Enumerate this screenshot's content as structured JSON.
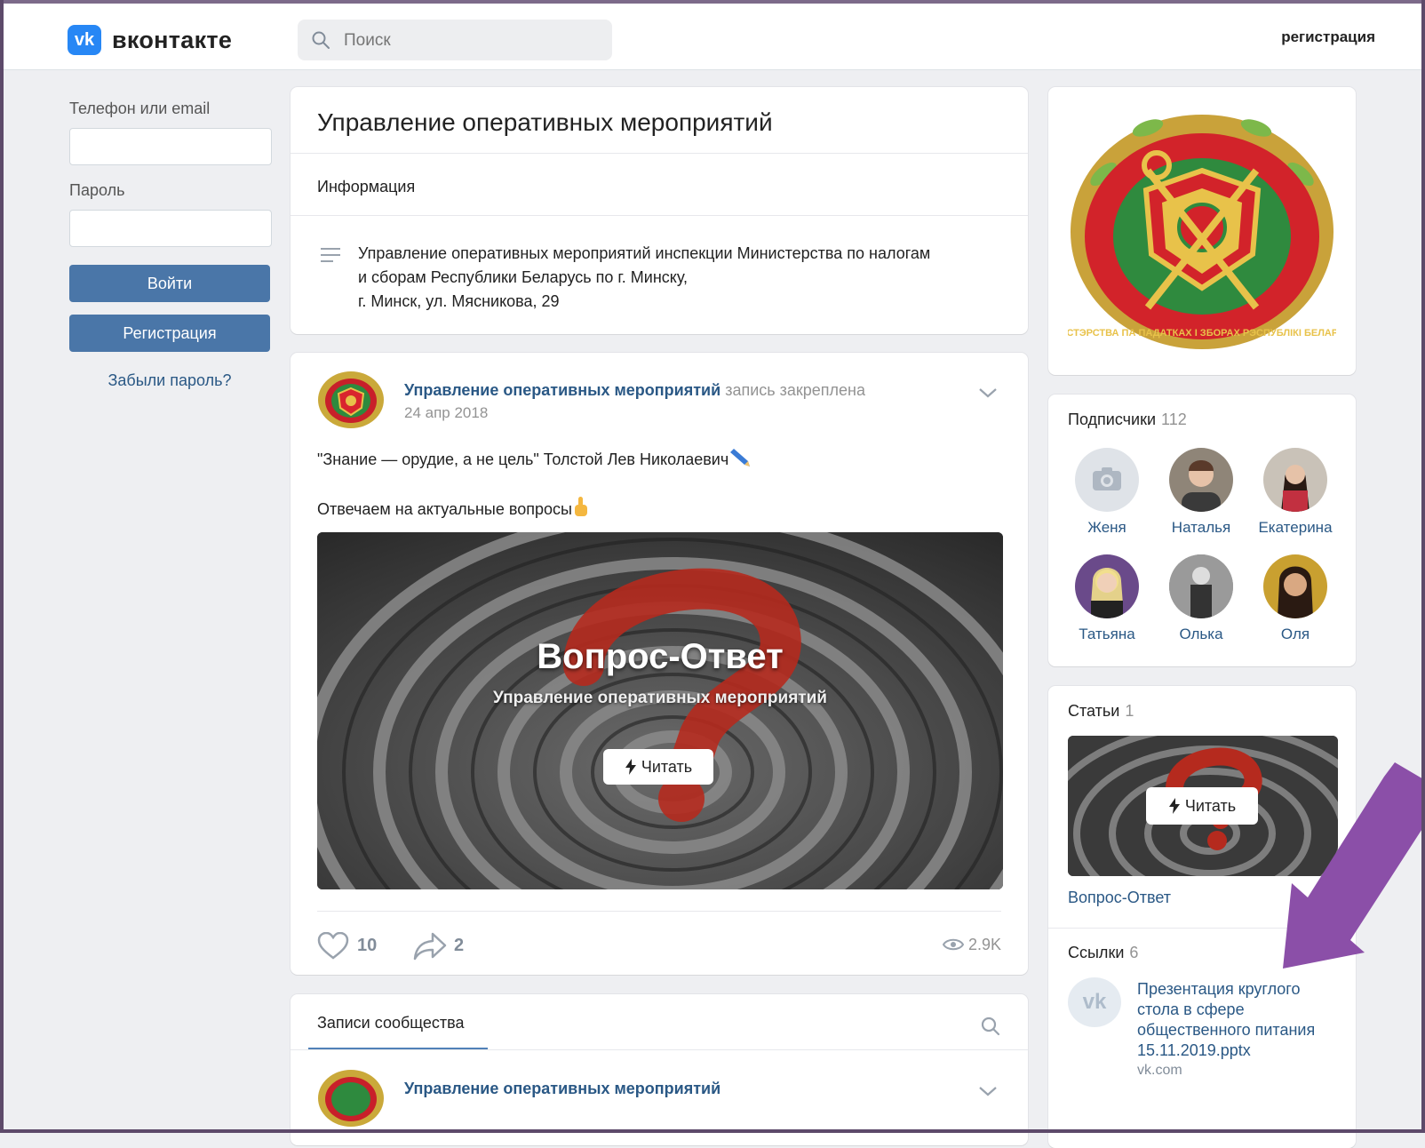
{
  "header": {
    "logo_text": "вконтакте",
    "search_placeholder": "Поиск",
    "register_link": "регистрация"
  },
  "login": {
    "phone_label": "Телефон или email",
    "password_label": "Пароль",
    "login_button": "Войти",
    "register_button": "Регистрация",
    "forgot_link": "Забыли пароль?"
  },
  "group": {
    "title": "Управление оперативных мероприятий",
    "info_label": "Информация",
    "description_lines": [
      "Управление оперативных мероприятий инспекции Министерства по налогам",
      "и сборам Республики Беларусь по г. Минску,",
      "г. Минск, ул. Мясникова, 29"
    ]
  },
  "post": {
    "author": "Управление оперативных мероприятий",
    "pinned": "запись закреплена",
    "date": "24 апр 2018",
    "text_line1": "\"Знание — орудие, а не цель\" Толстой Лев Николаевич",
    "text_line2": "Отвечаем на актуальные вопросы",
    "hero_title": "Вопрос-Ответ",
    "hero_subtitle": "Управление оперативных мероприятий",
    "read_button": "Читать",
    "likes": "10",
    "shares": "2",
    "views": "2.9K"
  },
  "wall": {
    "tab_label": "Записи сообщества",
    "next_author": "Управление оперативных мероприятий"
  },
  "subscribers": {
    "title": "Подписчики",
    "count": "112",
    "people": [
      {
        "name": "Женя",
        "color": "#dfe3e8"
      },
      {
        "name": "Наталья",
        "color": "#8f8578"
      },
      {
        "name": "Екатерина",
        "color": "#b84a55"
      },
      {
        "name": "Татьяна",
        "color": "#8a5aa3"
      },
      {
        "name": "Олька",
        "color": "#6d6d6d"
      },
      {
        "name": "Оля",
        "color": "#4a3526"
      }
    ]
  },
  "articles": {
    "title": "Статьи",
    "count": "1",
    "read_button": "Читать",
    "article_name": "Вопрос-Ответ"
  },
  "links": {
    "title": "Ссылки",
    "count": "6",
    "item_title": "Презентация круглого стола в сфере общественного питания 15.11.2019.pptx",
    "item_domain": "vk.com"
  },
  "emblem": {
    "ring_text": "МІНІСТЭРСТВА ПА ПАДАТКАХ І ЗБОРАХ РЭСПУБЛІКІ БЕЛАРУСЬ"
  },
  "colors": {
    "accent": "#4a76a8",
    "link": "#2a5885",
    "arrow": "#8b4fa8"
  }
}
